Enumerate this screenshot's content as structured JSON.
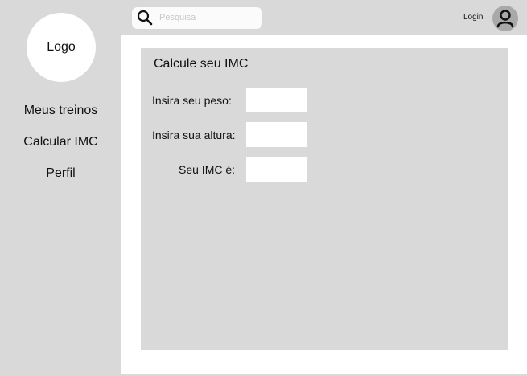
{
  "sidebar": {
    "logo_text": "Logo",
    "items": [
      {
        "label": "Meus treinos"
      },
      {
        "label": "Calcular IMC"
      },
      {
        "label": "Perfil"
      }
    ]
  },
  "header": {
    "search_placeholder": "Pesquisa",
    "login_label": "Login",
    "search_icon": "search-icon",
    "avatar_icon": "user-icon"
  },
  "main": {
    "title": "Calcule seu IMC",
    "fields": [
      {
        "label": "Insira seu peso:",
        "value": ""
      },
      {
        "label": "Insira sua altura:",
        "value": ""
      },
      {
        "label": "Seu IMC é:",
        "value": ""
      }
    ]
  },
  "colors": {
    "panel_gray": "#d9d9d9",
    "white": "#ffffff",
    "avatar_gray": "#a9a9a9",
    "icon_dark": "#111111"
  }
}
